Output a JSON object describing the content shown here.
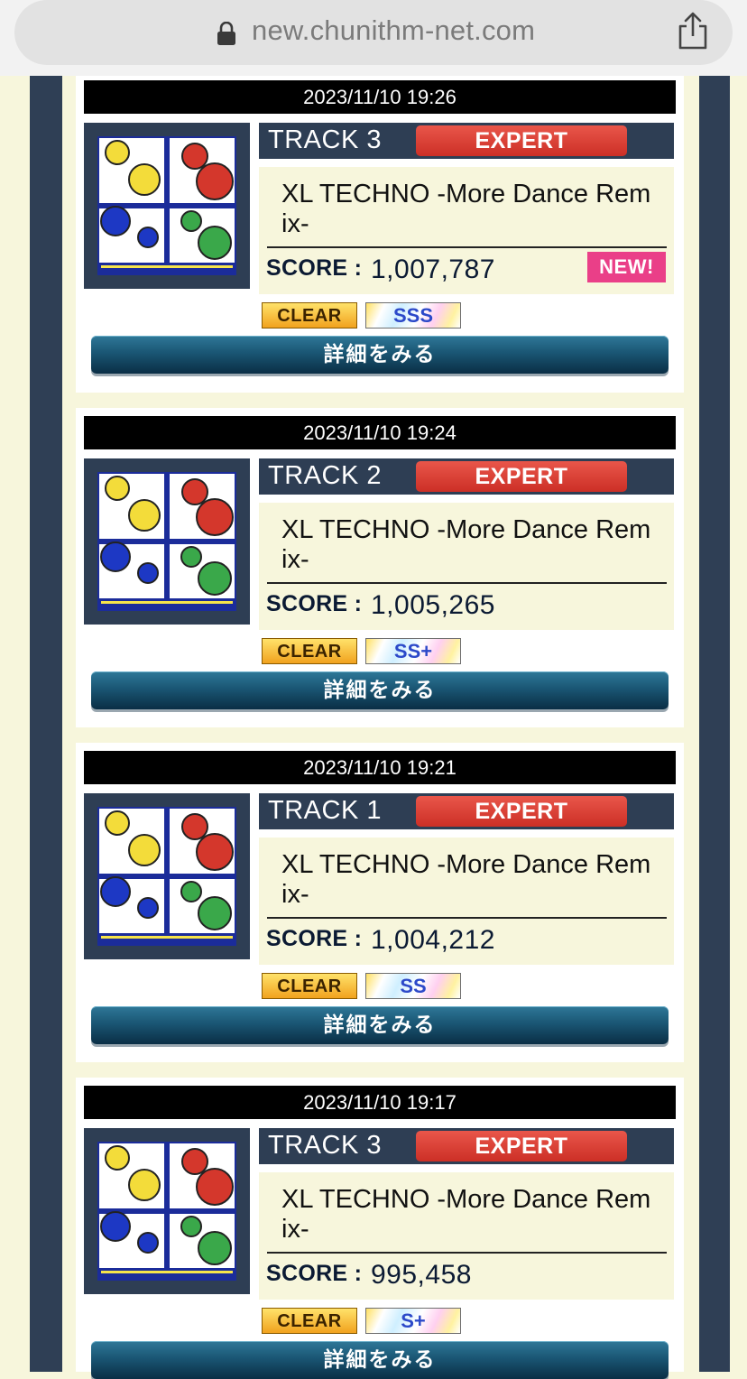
{
  "browser": {
    "url": "new.chunithm-net.com"
  },
  "detail_label": "詳細をみる",
  "plays": [
    {
      "date": "2023/11/10 19:26",
      "track": "TRACK 3",
      "difficulty": "EXPERT",
      "title": "XL TECHNO -More Dance Remix-",
      "score_label": "SCORE :",
      "score": "1,007,787",
      "new_label": "NEW!",
      "clear": "CLEAR",
      "rank": "SSS"
    },
    {
      "date": "2023/11/10 19:24",
      "track": "TRACK 2",
      "difficulty": "EXPERT",
      "title": "XL TECHNO -More Dance Remix-",
      "score_label": "SCORE :",
      "score": "1,005,265",
      "clear": "CLEAR",
      "rank": "SS+"
    },
    {
      "date": "2023/11/10 19:21",
      "track": "TRACK 1",
      "difficulty": "EXPERT",
      "title": "XL TECHNO -More Dance Remix-",
      "score_label": "SCORE :",
      "score": "1,004,212",
      "clear": "CLEAR",
      "rank": "SS"
    },
    {
      "date": "2023/11/10 19:17",
      "track": "TRACK 3",
      "difficulty": "EXPERT",
      "title": "XL TECHNO -More Dance Remix-",
      "score_label": "SCORE :",
      "score": "995,458",
      "clear": "CLEAR",
      "rank": "S+"
    }
  ],
  "colors": {
    "expert": "#d7372d",
    "new_badge": "#ea3f88",
    "frame": "#2f3f55",
    "background": "#f7f6dc"
  }
}
